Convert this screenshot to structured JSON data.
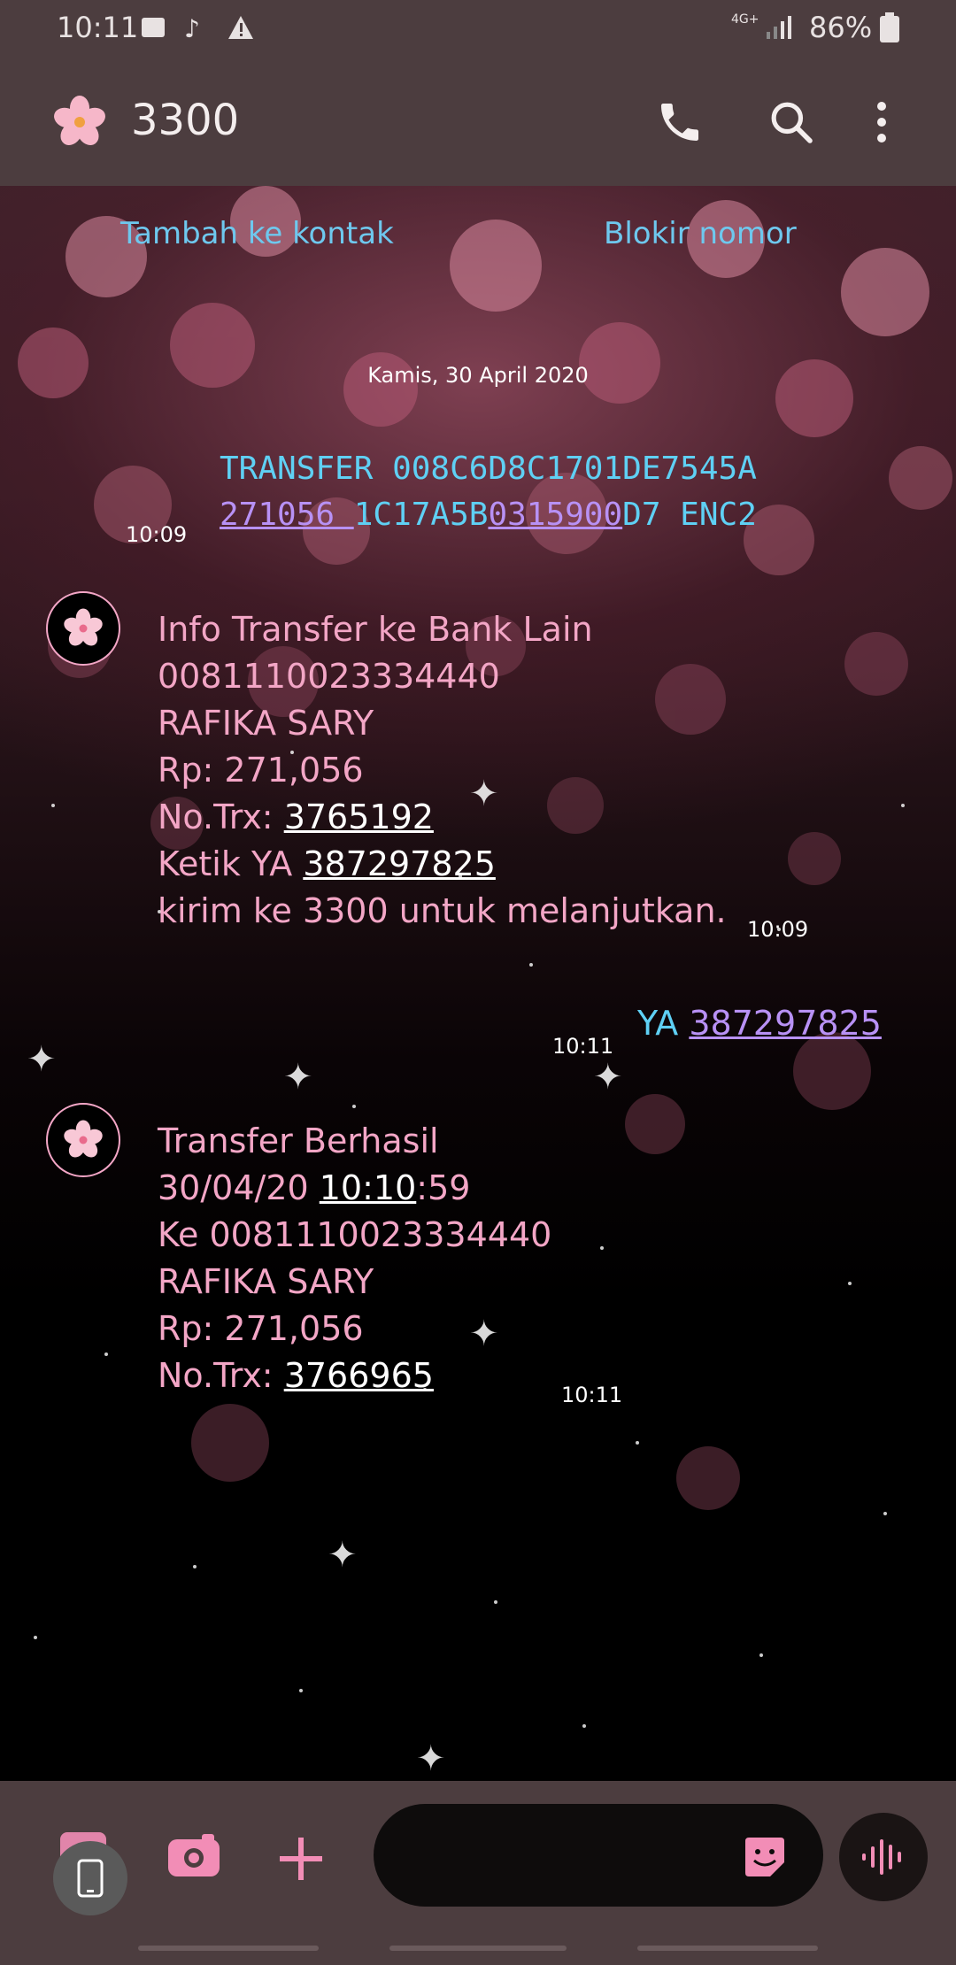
{
  "status_bar": {
    "time": "10:11",
    "network": "4G+",
    "battery": "86%"
  },
  "app_bar": {
    "title": "3300",
    "icons": [
      "flower-avatar-icon",
      "phone-icon",
      "search-icon",
      "more-icon"
    ]
  },
  "actions": {
    "add_contact": "Tambah ke kontak",
    "block_number": "Blokir nomor"
  },
  "date_header": "Kamis, 30 April 2020",
  "msg1": {
    "line1": "TRANSFER 008C6D8C1701DE7545A",
    "part_a": "271056 ",
    "part_b": "1C17A5B",
    "part_c": "0315900",
    "part_d": "D7 ENC2",
    "time": "10:09"
  },
  "msg2": {
    "line1": "Info Transfer ke Bank Lain",
    "line2": "0081110023334440",
    "line3": "RAFIKA SARY",
    "line4": "Rp: 271,056",
    "trx_label": "No.Trx: ",
    "trx_value": "3765192",
    "ketik_label": "Ketik YA ",
    "ketik_value": "387297825",
    "line7": "kirim ke 3300 untuk melanjutkan.",
    "time": "10:09"
  },
  "msg3": {
    "prefix": "YA ",
    "code": "387297825",
    "time": "10:11"
  },
  "msg4": {
    "line1": "Transfer Berhasil",
    "date_part": "30/04/20 ",
    "time_part": "10:10",
    "sec_part": ":59",
    "line3": "Ke 0081110023334440",
    "line4": "RAFIKA SARY",
    "line5": "Rp: 271,056",
    "trx_label": "No.Trx: ",
    "trx_value": "3766965",
    "time": "10:11"
  },
  "colors": {
    "bar": "#4c3d3f",
    "sent_text": "#5fd0f4",
    "recv_text": "#f3a6c6",
    "link": "#b891f5",
    "accent": "#f28db6"
  }
}
